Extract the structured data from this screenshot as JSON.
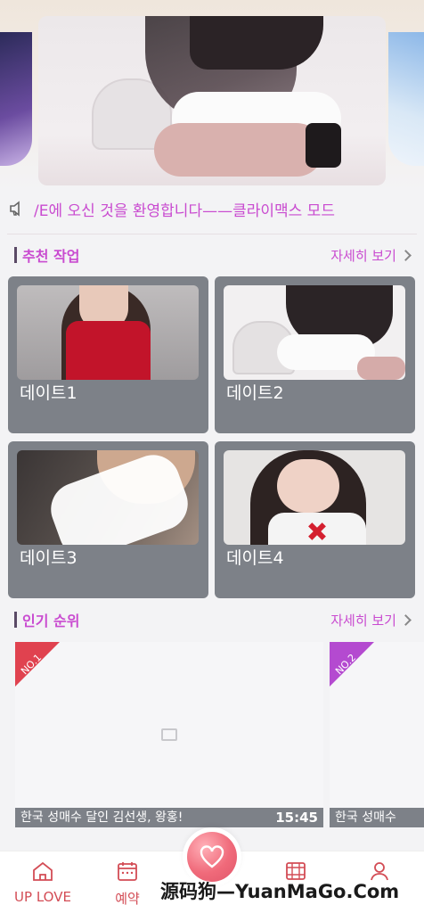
{
  "notice": {
    "text": "/E에 오신 것을 환영합니다——클라이맥스 모드",
    "icon": "speaker-icon"
  },
  "recommended": {
    "title": "추천 작업",
    "more_label": "자세히 보기",
    "cards": [
      {
        "label": "데이트1"
      },
      {
        "label": "데이트2"
      },
      {
        "label": "데이트3"
      },
      {
        "label": "데이트4"
      }
    ]
  },
  "ranking": {
    "title": "인기 순위",
    "more_label": "자세히 보기",
    "items": [
      {
        "badge": "NO.1",
        "caption": "한국 성매수 달인 김선생, 왕홍!",
        "duration": "15:45",
        "color": "#e0424f"
      },
      {
        "badge": "NO.2",
        "caption": "한국 성매수",
        "color": "#b44ad0"
      }
    ]
  },
  "bottom_nav": {
    "items": [
      {
        "label": "UP LOVE",
        "icon": "home-icon"
      },
      {
        "label": "예약",
        "icon": "calendar-icon"
      },
      {
        "label": "",
        "icon": "heart-icon"
      },
      {
        "label": "",
        "icon": "film-icon"
      },
      {
        "label": "",
        "icon": "user-icon"
      }
    ]
  },
  "watermark": "源码狗—YuanMaGo.Com",
  "colors": {
    "accent": "#c94bd0",
    "card_bg": "#7d8188",
    "nav_accent": "#d34c55"
  }
}
